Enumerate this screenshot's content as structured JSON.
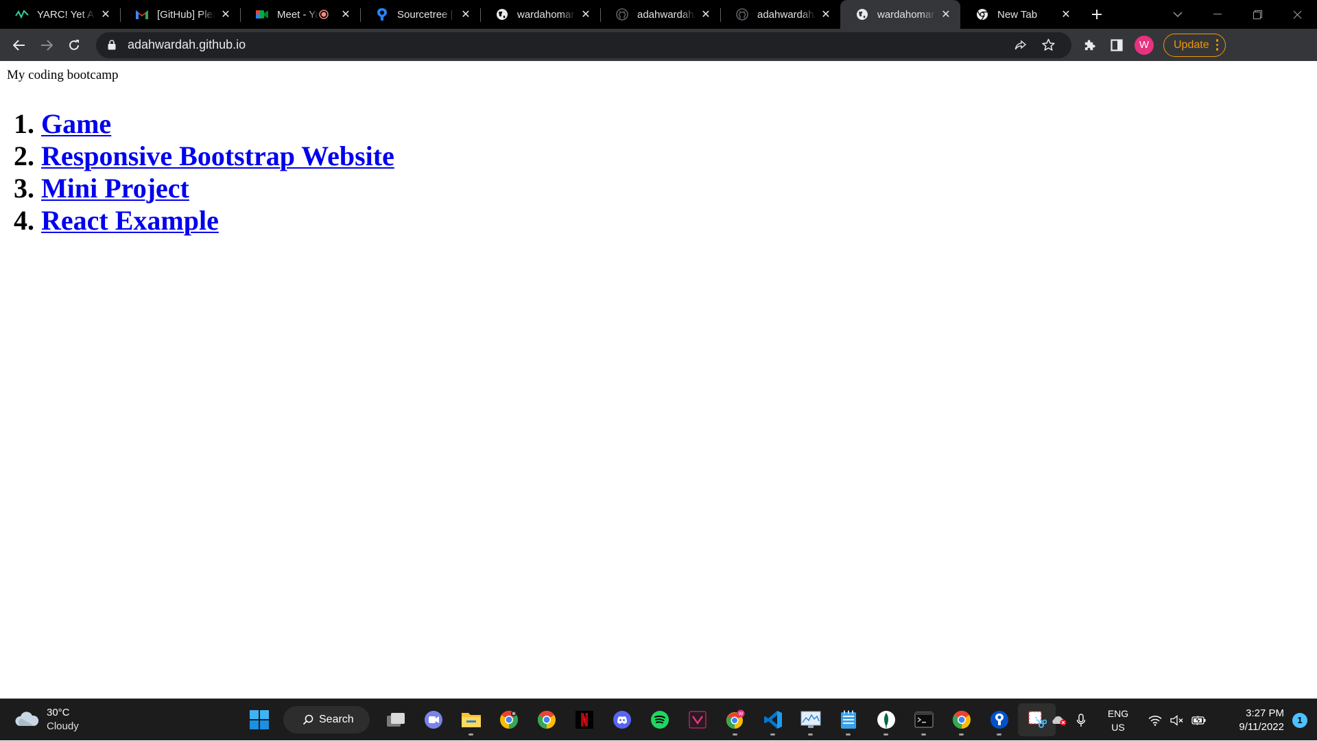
{
  "browser": {
    "tabs": [
      {
        "title": "YARC! Yet Another REST Client",
        "icon": "yarc-wave-icon",
        "active": false
      },
      {
        "title": "[GitHub] Please verify your device",
        "icon": "gmail-icon",
        "active": false
      },
      {
        "title": "Meet - Yay",
        "icon": "google-meet-icon",
        "active": false,
        "recording": true
      },
      {
        "title": "Sourcetree | Free Git GUI",
        "icon": "sourcetree-icon",
        "active": false
      },
      {
        "title": "wardahomar - Overview",
        "icon": "globe-icon",
        "active": false
      },
      {
        "title": "adahwardah/adahwardah.github.io",
        "icon": "github-icon",
        "active": false
      },
      {
        "title": "adahwardah/adahwardah.github.io",
        "icon": "github-icon",
        "active": false
      },
      {
        "title": "wardahomar",
        "icon": "globe-icon",
        "active": true
      },
      {
        "title": "New Tab",
        "icon": "chrome-icon",
        "active": false
      }
    ],
    "url": "adahwardah.github.io",
    "update_label": "Update",
    "avatar_initial": "W",
    "accent": "#f29900"
  },
  "page": {
    "intro": "My coding bootcamp",
    "links": [
      {
        "label": "Game"
      },
      {
        "label": "Responsive Bootstrap Website"
      },
      {
        "label": "Mini Project"
      },
      {
        "label": "React Example"
      }
    ],
    "link_color": "#0000ee"
  },
  "taskbar": {
    "weather": {
      "temp": "30°C",
      "condition": "Cloudy"
    },
    "search_label": "Search",
    "lang": {
      "line1": "ENG",
      "line2": "US"
    },
    "clock": {
      "time": "3:27 PM",
      "date": "9/11/2022"
    },
    "notifications": "1",
    "apps": [
      "windows-start-icon",
      "search",
      "task-view-icon",
      "teams-chat-icon",
      "file-explorer-icon",
      "chrome-canary-icon",
      "chrome-icon",
      "netflix-icon",
      "discord-icon",
      "spotify-icon",
      "vectr-icon",
      "chrome-profile-icon",
      "vscode-icon",
      "resource-monitor-icon",
      "notepad-icon",
      "mongodb-compass-icon",
      "terminal-icon",
      "chrome-icon-2",
      "sourcetree-icon",
      "snipping-tool-icon"
    ]
  }
}
